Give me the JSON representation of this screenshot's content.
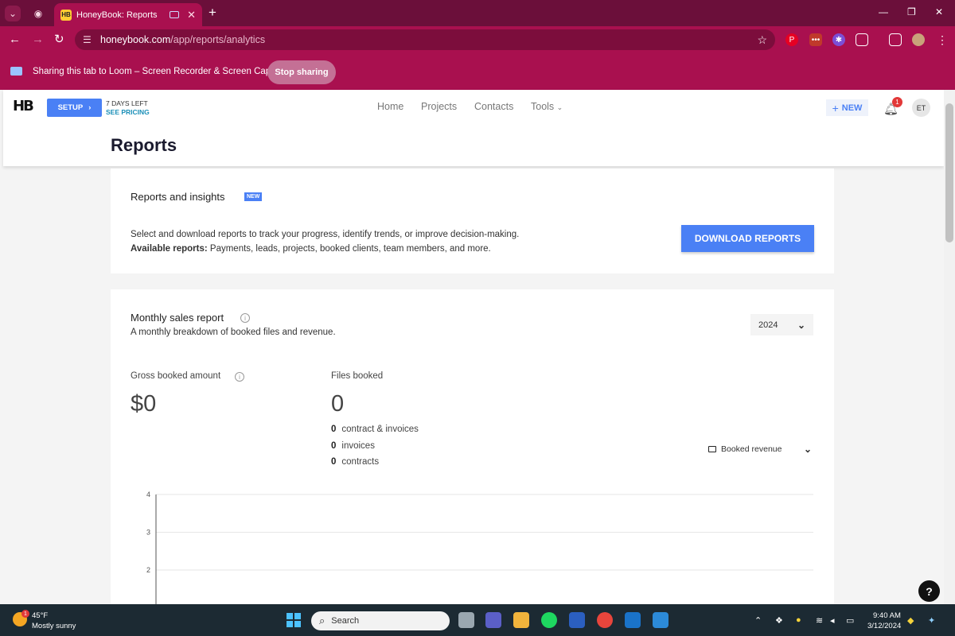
{
  "browser": {
    "tab_title": "HoneyBook: Reports",
    "tab_favicon": "HB",
    "new_tab": "+",
    "url_host": "honeybook.com",
    "url_path": "/app/reports/analytics",
    "share_text": "Sharing this tab to Loom – Screen Recorder & Screen Capture",
    "stop_sharing": "Stop sharing"
  },
  "header": {
    "logo": "HB",
    "setup_label": "SETUP",
    "trial_days": "7 DAYS LEFT",
    "see_pricing": "SEE PRICING",
    "nav": [
      "Home",
      "Projects",
      "Contacts",
      "Tools"
    ],
    "new_label": "NEW",
    "notification_count": "1",
    "avatar_initials": "ET",
    "page_title": "Reports"
  },
  "insights": {
    "title": "Reports and insights",
    "badge": "NEW",
    "description": "Select and download reports to track your progress, identify trends, or improve decision-making.",
    "available_label": "Available reports:",
    "available_text": " Payments, leads, projects, booked clients, team members, and more.",
    "download_label": "DOWNLOAD REPORTS"
  },
  "monthly": {
    "title": "Monthly sales report",
    "subtitle": "A monthly breakdown of booked files and revenue.",
    "year": "2024",
    "gross_label": "Gross booked amount",
    "gross_value": "$0",
    "files_label": "Files booked",
    "files_value": "0",
    "breakdown": [
      {
        "count": "0",
        "label": "contract & invoices"
      },
      {
        "count": "0",
        "label": "invoices"
      },
      {
        "count": "0",
        "label": "contracts"
      }
    ],
    "chart_metric": "Booked revenue"
  },
  "chart_data": {
    "type": "bar",
    "categories": [],
    "values": [],
    "y_ticks": [
      "4",
      "3",
      "2"
    ],
    "ylim": [
      0,
      4
    ],
    "grid": true
  },
  "help": "?",
  "taskbar": {
    "weather_badge": "1",
    "temp": "45°F",
    "weather": "Mostly sunny",
    "search_label": "Search",
    "time": "9:40 AM",
    "date": "3/12/2024"
  },
  "colors": {
    "accent": "#4a80f5",
    "browser_frame": "#a9104f",
    "tab_strip": "#6b0f3a"
  }
}
